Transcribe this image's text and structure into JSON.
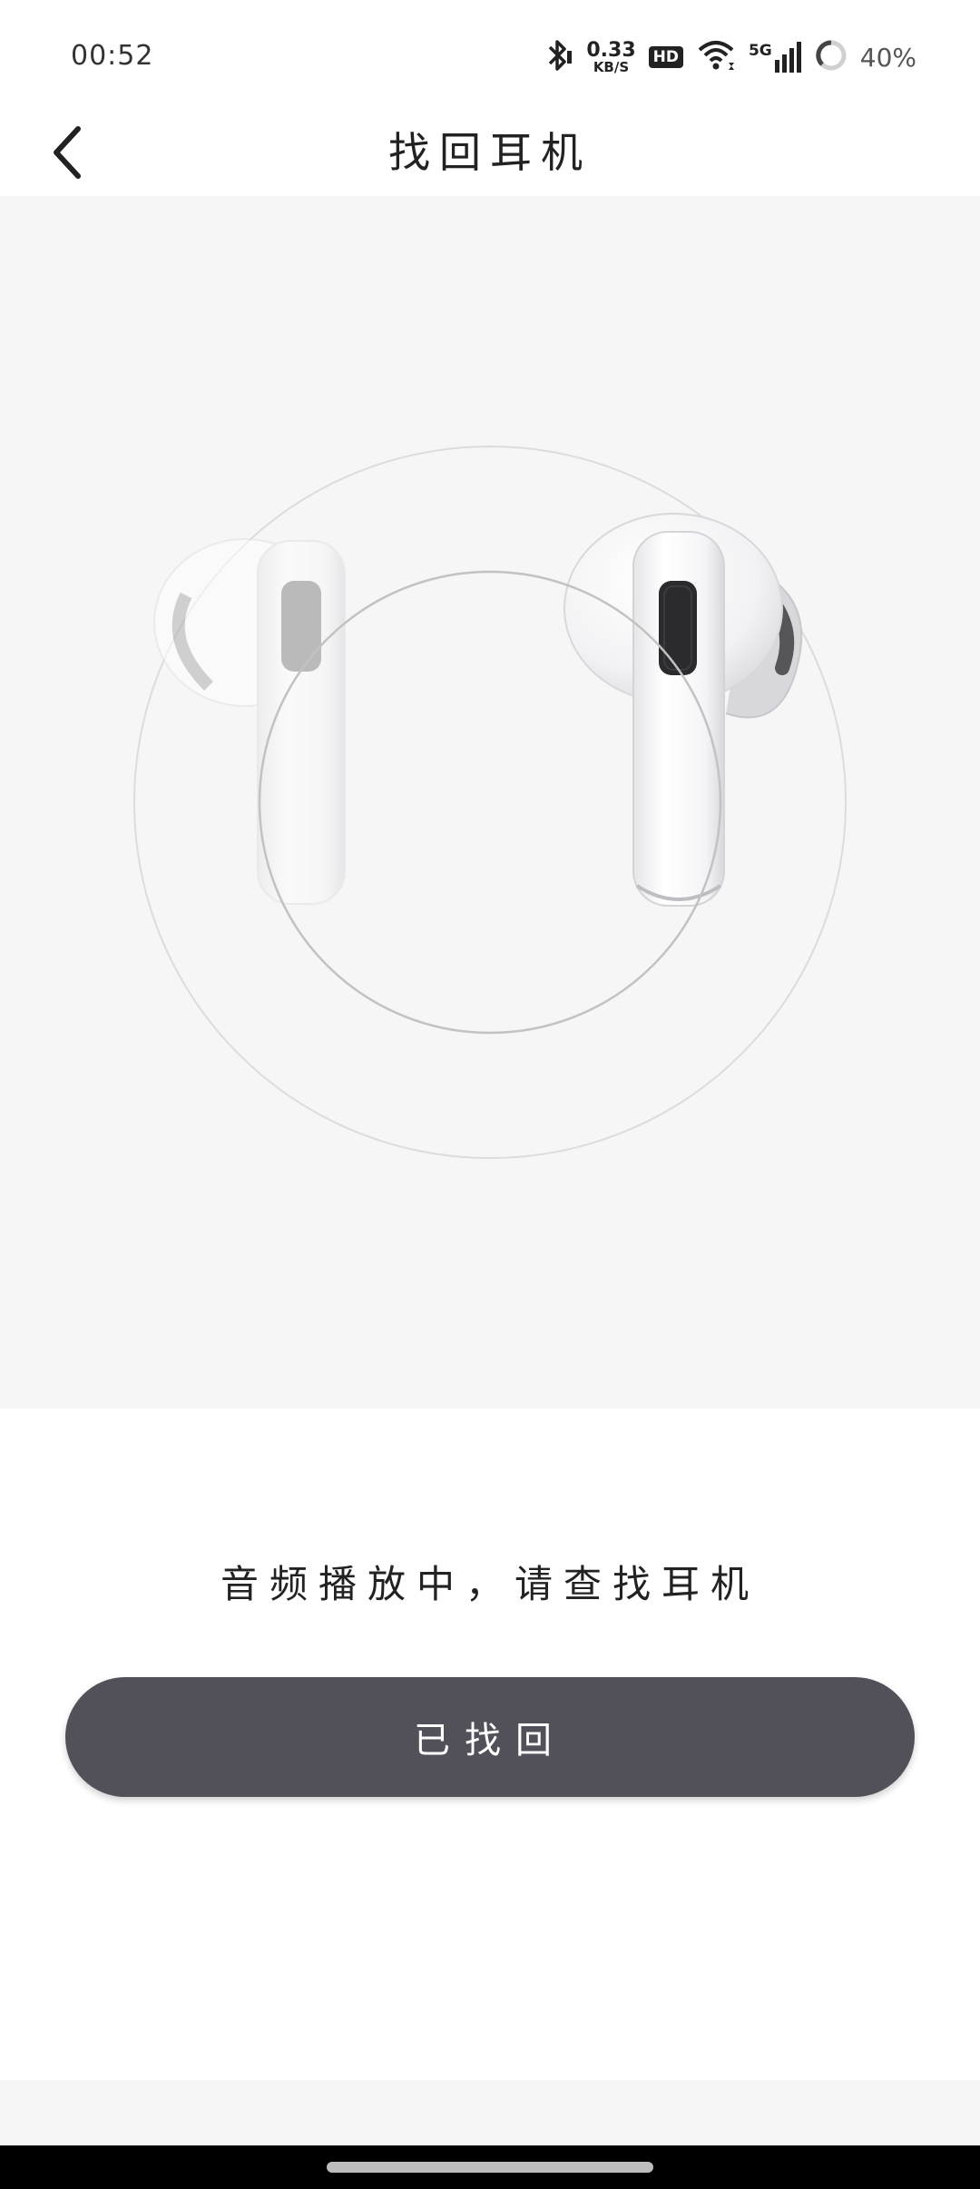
{
  "status_bar": {
    "time": "00:52",
    "net_speed_value": "0.33",
    "net_speed_unit": "KB/S",
    "hd_label": "HD",
    "signal_label": "5G",
    "battery_percent": "40%",
    "icons": [
      "bluetooth-icon",
      "hd-icon",
      "wifi-icon",
      "signal-5g-icon",
      "battery-icon"
    ]
  },
  "header": {
    "back_icon": "chevron-left-icon",
    "title": "找回耳机"
  },
  "main": {
    "hint_text": "音频播放中，请查找耳机",
    "found_button_label": "已找回"
  },
  "colors": {
    "hero_background": "#f6f6f6",
    "button_background": "#525159",
    "button_text": "#ffffff"
  }
}
